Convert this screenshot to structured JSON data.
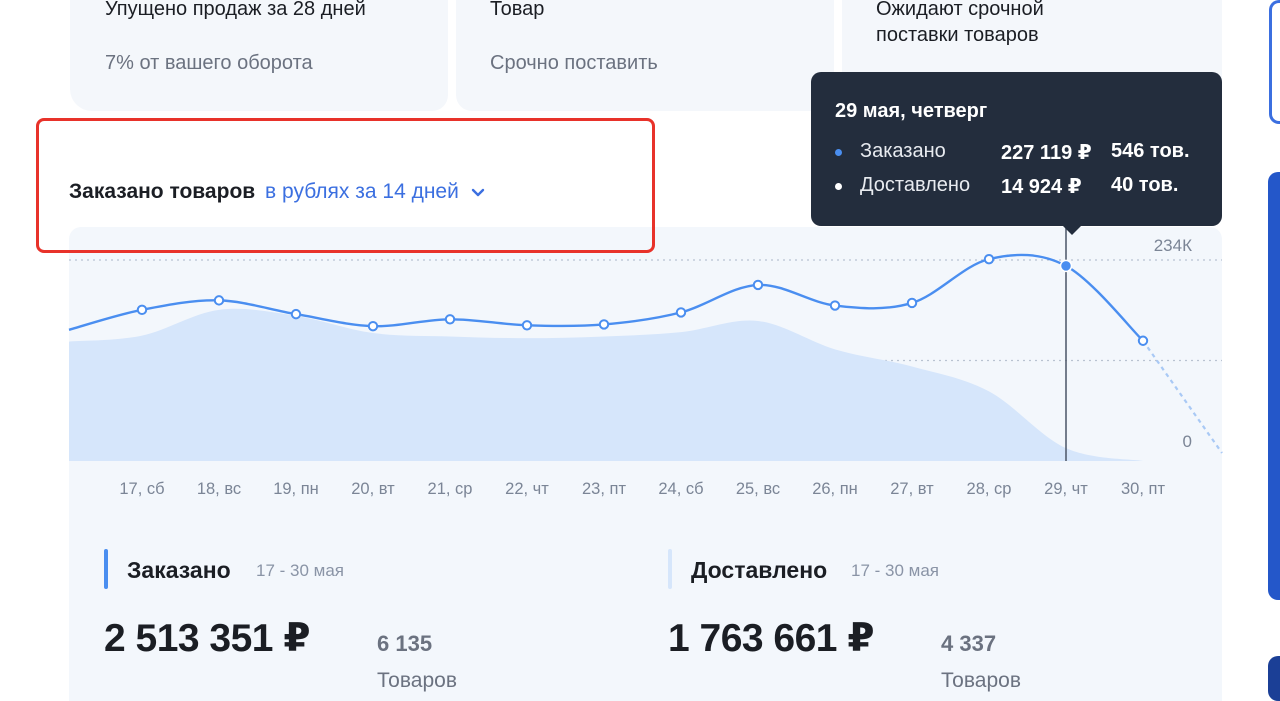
{
  "top_cards": [
    {
      "title": "Упущено продаж за 28 дней",
      "subtitle": "7% от вашего оборота"
    },
    {
      "title": "Товар",
      "subtitle": "Срочно поставить"
    },
    {
      "title_line1": "Ожидают срочной",
      "title_line2": "поставки товаров"
    }
  ],
  "chart_header": {
    "title": "Заказано товаров",
    "period": "в рублях за 14 дней"
  },
  "tooltip": {
    "title": "29 мая, четверг",
    "rows": [
      {
        "label": "Заказано",
        "value": "227 119 ₽",
        "count": "546 тов.",
        "color": "#4a8ef0"
      },
      {
        "label": "Доставлено",
        "value": "14 924 ₽",
        "count": "40 тов.",
        "color": "#ffffff"
      }
    ]
  },
  "chart_data": {
    "type": "line",
    "x": [
      "17, сб",
      "18, вс",
      "19, пн",
      "20, вт",
      "21, ср",
      "22, чт",
      "23, пт",
      "24, сб",
      "25, вс",
      "26, пн",
      "27, вт",
      "28, ср",
      "29, чт",
      "30, пт"
    ],
    "ylim": [
      0,
      234000
    ],
    "ytick_labels": [
      "234К",
      "0"
    ],
    "series": [
      {
        "name": "Заказано",
        "type": "line",
        "color": "#4a8ef0",
        "values": [
          176000,
          187000,
          171000,
          157000,
          165000,
          158000,
          159000,
          173000,
          205000,
          181000,
          184000,
          235000,
          227119,
          140000
        ]
      },
      {
        "name": "Доставлено",
        "type": "area",
        "color": "#d6e6fb",
        "values": [
          146000,
          176000,
          169000,
          149000,
          145000,
          143000,
          145000,
          150000,
          163000,
          130000,
          110000,
          81000,
          14924,
          0
        ]
      }
    ],
    "highlighted_index": 12
  },
  "summary": [
    {
      "label": "Заказано",
      "range": "17 - 30 мая",
      "amount": "2 513 351 ₽",
      "qty": "6 135",
      "qty_label": "Товаров",
      "color": "#4a8ef0"
    },
    {
      "label": "Доставлено",
      "range": "17 - 30 мая",
      "amount": "1 763 661 ₽",
      "qty": "4 337",
      "qty_label": "Товаров",
      "color": "#d6e6fb"
    }
  ]
}
